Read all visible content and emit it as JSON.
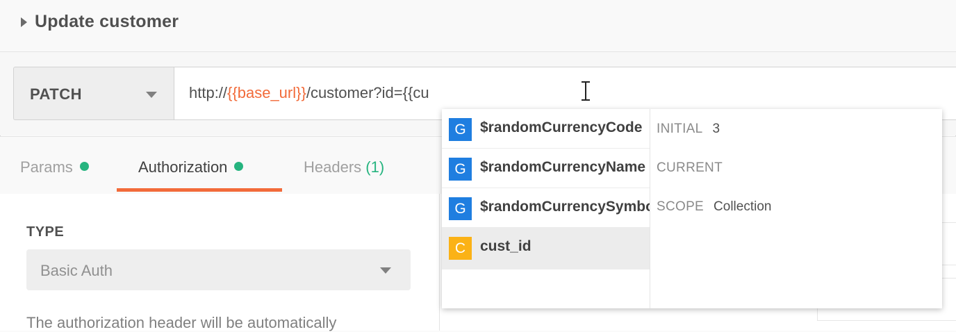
{
  "request": {
    "title": "Update customer",
    "method": "PATCH",
    "url_prefix": "http://",
    "url_variable": "{{base_url}}",
    "url_suffix": "/customer?id={{cu"
  },
  "tabs": [
    {
      "label": "Params",
      "indicator": "dot",
      "active": false
    },
    {
      "label": "Authorization",
      "indicator": "dot",
      "active": true
    },
    {
      "label": "Headers",
      "count": "(1)",
      "active": false
    }
  ],
  "auth": {
    "type_label": "TYPE",
    "type_value": "Basic Auth",
    "description": "The authorization header will be automatically"
  },
  "autocomplete": {
    "items": [
      {
        "badge": "G",
        "name": "$randomCurrencyCode",
        "selected": false
      },
      {
        "badge": "G",
        "name": "$randomCurrencyName",
        "selected": false
      },
      {
        "badge": "G",
        "name": "$randomCurrencySymbol",
        "selected": false
      },
      {
        "badge": "C",
        "name": "cust_id",
        "selected": true
      }
    ],
    "detail": {
      "initial_label": "INITIAL",
      "initial_value": "3",
      "current_label": "CURRENT",
      "current_value": "",
      "scope_label": "SCOPE",
      "scope_value": "Collection"
    }
  },
  "colors": {
    "accent": "#f26b3a",
    "status_green": "#26b47f",
    "global_badge": "#1f7ee0",
    "collection_badge": "#fbb216"
  }
}
